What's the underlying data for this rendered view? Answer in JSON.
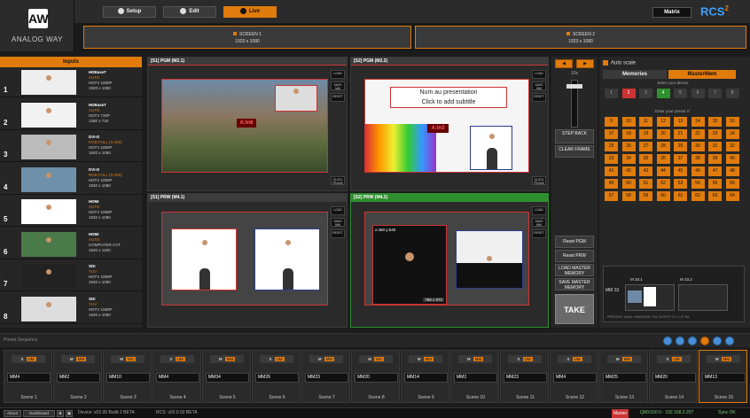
{
  "brand": {
    "logo_text": "AW",
    "name": "ANALOG WAY"
  },
  "topbar": {
    "setup": "Setup",
    "edit": "Edit",
    "live": "Live",
    "matrix": "Matrix",
    "rcs": "RCS",
    "rcs_sup": "2"
  },
  "screens": [
    {
      "name": "SCREEN 1",
      "res": "1920 x 1080"
    },
    {
      "name": "SCREEN 2",
      "res": "1920 x 1080"
    }
  ],
  "inputs": {
    "header": "Inputs",
    "items": [
      {
        "num": "1",
        "name": "HDBaseT",
        "l2": "AUTO",
        "l3": "HDTV 1080P",
        "l4": "1920 x 1080"
      },
      {
        "num": "2",
        "name": "HDBaseT",
        "l2": "AUTO",
        "l3": "HDTV 720P",
        "l4": "1280 x 720"
      },
      {
        "num": "3",
        "name": "DVI-D",
        "l2": "RGB FULL (0-255)",
        "l3": "HDTV 1080P",
        "l4": "1920 x 1080"
      },
      {
        "num": "4",
        "name": "DVI-D",
        "l2": "RGB FULL (0-255)",
        "l3": "HDTV 1080P",
        "l4": "1920 x 1080"
      },
      {
        "num": "5",
        "name": "HDMI",
        "l2": "AUTO",
        "l3": "HDTV 1080P",
        "l4": "1920 x 1080"
      },
      {
        "num": "6",
        "name": "HDMI",
        "l2": "AUTO",
        "l3": "COMPUTER CVT",
        "l4": "1920 x 1200"
      },
      {
        "num": "7",
        "name": "SDI",
        "l2": "YUV",
        "l3": "HDTV 1080P",
        "l4": "1920 x 1080"
      },
      {
        "num": "8",
        "name": "SDI",
        "l2": "YUV",
        "l3": "HDTV 1080P",
        "l4": "1920 x 1080"
      }
    ]
  },
  "panels": {
    "s1_pgm": "[S1] PGM (M2.1)",
    "s2_pgm": "[S2] PGM (M2.2)",
    "s1_prw": "[S1] PRW (M4.1)",
    "s2_prw": "[S2] PRW (M4.2)",
    "side_buttons": [
      "LOAD",
      "SAVE MM",
      "RESET"
    ],
    "quick_frame": "QUICK FRAME",
    "slide_title": "Num au presentation",
    "slide_subtitle": "Click to add subtitle",
    "layer_tag_1": "A:In6",
    "layer_tag_2": "A:In3",
    "size_tag_1": "x:460 y:540",
    "size_tag_2": "768 x 972"
  },
  "midctrl": {
    "auto_scale_value": "10s",
    "step_back": "STEP BACK",
    "clear_frame": "CLEAR FRAME",
    "reset_pgm": "Reset PGM",
    "reset_prw": "Reset PRW",
    "load_master": "LOAD MASTER MEMORY",
    "save_master": "SAVE MASTER MEMORY",
    "take": "TAKE"
  },
  "memory": {
    "auto_scale": "Auto scale",
    "tab_memories": "Memories",
    "tab_master": "MasterMem",
    "enter_device": "Enter your device",
    "enter_preset": "Enter your preset n°",
    "row1": [
      "1",
      "2",
      "3",
      "4",
      "5",
      "6",
      "7",
      "8"
    ],
    "grid": [
      "9",
      "10",
      "11",
      "12",
      "13",
      "14",
      "15",
      "16",
      "17",
      "18",
      "19",
      "20",
      "21",
      "22",
      "23",
      "24",
      "25",
      "26",
      "27",
      "28",
      "29",
      "30",
      "31",
      "32",
      "33",
      "34",
      "35",
      "36",
      "37",
      "38",
      "39",
      "40",
      "41",
      "42",
      "43",
      "44",
      "45",
      "46",
      "47",
      "48",
      "49",
      "50",
      "51",
      "52",
      "53",
      "54",
      "55",
      "56",
      "57",
      "58",
      "59",
      "60",
      "61",
      "62",
      "63",
      "64"
    ],
    "mm_label": "MM 33",
    "preview_a": "M 33.1",
    "preview_b": "M 33.2",
    "caption": "PREVIEW / Direct / MM#33/35 / 2X1 OUTPUT 3 / 1 / 67 NA"
  },
  "preset_sequence": {
    "label": "Preset Sequence"
  },
  "scenes": [
    {
      "left": "S",
      "tag": "UM",
      "field": "MM4",
      "label": "Scene 1"
    },
    {
      "left": "M",
      "tag": "MM",
      "field": "MM2",
      "label": "Scene 2"
    },
    {
      "left": "M",
      "tag": "MV",
      "field": "MM10",
      "label": "Scene 3"
    },
    {
      "left": "S",
      "tag": "UM",
      "field": "MM4",
      "label": "Scene 4"
    },
    {
      "left": "M",
      "tag": "MM",
      "field": "MM34",
      "label": "Scene 5"
    },
    {
      "left": "S",
      "tag": "UM",
      "field": "MM26",
      "label": "Scene 6"
    },
    {
      "left": "M",
      "tag": "MM",
      "field": "MM23",
      "label": "Scene 7"
    },
    {
      "left": "M",
      "tag": "MV",
      "field": "MM20",
      "label": "Scene 8"
    },
    {
      "left": "M",
      "tag": "MM",
      "field": "MM14",
      "label": "Scene 9"
    },
    {
      "left": "M",
      "tag": "MM",
      "field": "MM2",
      "label": "Scene 10"
    },
    {
      "left": "S",
      "tag": "UM",
      "field": "MM23",
      "label": "Scene 11"
    },
    {
      "left": "S",
      "tag": "UM",
      "field": "MM4",
      "label": "Scene 12"
    },
    {
      "left": "M",
      "tag": "MM",
      "field": "MM25",
      "label": "Scene 13"
    },
    {
      "left": "S",
      "tag": "UM",
      "field": "MM20",
      "label": "Scene 14"
    },
    {
      "left": "M",
      "tag": "MM",
      "field": "MM13",
      "label": "Scene 15"
    }
  ],
  "status": {
    "about": "About",
    "dashboard": "Dashboard",
    "device": "Device: v02.00 Build 2 BETA",
    "rcs": "RCS: v02.0.02 BETA",
    "master": "Master",
    "ip": "QMX150 II - 192.168.2.207",
    "sync": "Sync OK"
  },
  "colors": {
    "accent": "#e07b0c",
    "pgm": "#cc3333",
    "prw": "#2f8f2f",
    "link": "#3ea0ff"
  }
}
